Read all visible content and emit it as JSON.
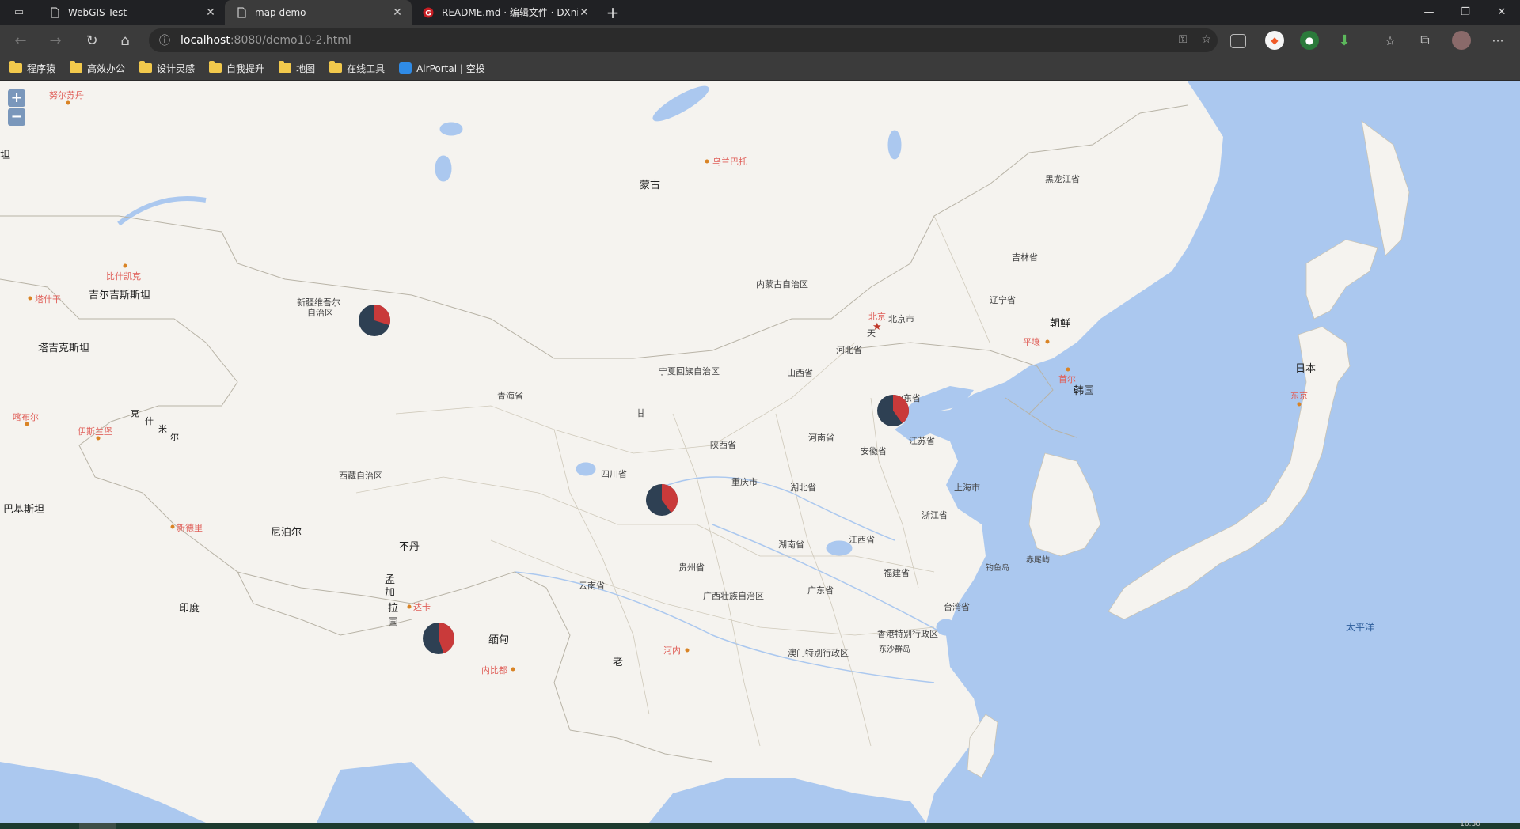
{
  "tabs": [
    {
      "title": "WebGIS Test",
      "active": false
    },
    {
      "title": "map demo",
      "active": true
    },
    {
      "title": "README.md · 编辑文件 · DXnim...",
      "active": false
    }
  ],
  "address": {
    "host": "localhost",
    "path": ":8080/demo10-2.html"
  },
  "bookmarks": [
    {
      "label": "程序猿",
      "icon": "folder-icon"
    },
    {
      "label": "高效办公",
      "icon": "folder-icon"
    },
    {
      "label": "设计灵感",
      "icon": "folder-icon"
    },
    {
      "label": "自我提升",
      "icon": "folder-icon"
    },
    {
      "label": "地图",
      "icon": "folder-icon"
    },
    {
      "label": "在线工具",
      "icon": "folder-icon"
    },
    {
      "label": "AirPortal | 空投",
      "icon": "cloud-icon"
    }
  ],
  "zoom": {
    "in": "+",
    "out": "−"
  },
  "map": {
    "country_labels": [
      "蒙古",
      "吉尔吉斯斯坦",
      "塔吉克斯坦",
      "巴基斯坦",
      "尼泊尔",
      "不丹",
      "印度",
      "朝鲜",
      "韩国",
      "日本",
      "缅甸",
      "老",
      "坦",
      "克",
      "什",
      "米",
      "尔",
      "孟",
      "加",
      "拉",
      "国"
    ],
    "province_labels": [
      "黑龙江省",
      "吉林省",
      "辽宁省",
      "内蒙古自治区",
      "新疆维吾尔",
      "自治区",
      "北京市",
      "天",
      "河北省",
      "山西省",
      "宁夏回族自治区",
      "青海省",
      "甘",
      "山东省",
      "河南省",
      "江苏省",
      "安徽省",
      "陕西省",
      "四川省",
      "西藏自治区",
      "重庆市",
      "湖北省",
      "上海市",
      "浙江省",
      "湖南省",
      "江西省",
      "贵州省",
      "福建省",
      "云南省",
      "广西壮族自治区",
      "广东省",
      "台湾省",
      "香港特别行政区",
      "澳门特别行政区",
      "钓鱼岛",
      "赤尾屿",
      "东沙群岛",
      "太平洋"
    ],
    "capital_labels": [
      "努尔苏丹",
      "乌兰巴托",
      "比什凯克",
      "塔什干",
      "喀布尔",
      "伊斯兰堡",
      "新德里",
      "北京",
      "平壤",
      "首尔",
      "东京",
      "达卡",
      "河内",
      "内比都"
    ]
  },
  "pie_series": [
    {
      "region": "新疆",
      "dark_share": 0.7,
      "red_share": 0.3
    },
    {
      "region": "北京",
      "dark_share": 0.6,
      "red_share": 0.4
    },
    {
      "region": "甘肃",
      "dark_share": 0.6,
      "red_share": 0.4
    },
    {
      "region": "西藏",
      "dark_share": 0.55,
      "red_share": 0.45
    }
  ],
  "colors": {
    "sea": "#abc8ef",
    "land": "#f5f3ef",
    "pie_dark": "#2e4053",
    "pie_red": "#c93a3a",
    "capital_text": "#e0605a"
  },
  "status": {
    "time": "16:30"
  }
}
